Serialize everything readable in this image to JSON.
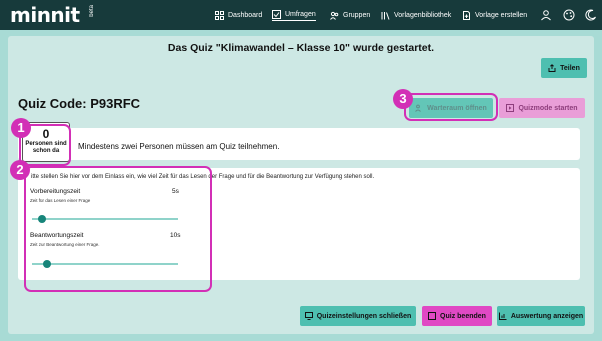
{
  "nav": {
    "logo": "minnit",
    "logo_badge": "beta",
    "items": [
      {
        "label": "Dashboard",
        "icon": "grid-icon"
      },
      {
        "label": "Umfragen",
        "icon": "survey-icon"
      },
      {
        "label": "Gruppen",
        "icon": "group-icon"
      },
      {
        "label": "Vorlagenbibliothek",
        "icon": "library-icon"
      },
      {
        "label": "Vorlage erstellen",
        "icon": "document-plus-icon"
      }
    ],
    "right_icons": [
      "user-icon",
      "palette-icon",
      "moon-icon"
    ]
  },
  "banner": {
    "message": "Das Quiz \"Klimawandel – Klasse 10\" wurde gestartet.",
    "share_label": "Teilen"
  },
  "quiz": {
    "code_label": "Quiz Code: P93RFC",
    "waiting_room_label": "Warteraum öffnen",
    "start_quiz_mode_label": "Quizmode starten"
  },
  "participants": {
    "count": "0",
    "count_label": "Personen sind schon da",
    "minimum_note": "Mindestens zwei Personen müssen am Quiz teilnehmen."
  },
  "timing": {
    "instruction": "itte stellen Sie hier vor dem Einlass ein, wie viel Zeit für das Lesen der Frage und für die Beantwortung zur Verfügung stehen soll.",
    "prep": {
      "label": "Vorbereitungszeit",
      "sub": "Zeit für das Lesen einer Frage",
      "value": "5s",
      "level": 0.05
    },
    "answer": {
      "label": "Beantwortungszeit",
      "sub": "Zeit zur Beantwortung einer Frage.",
      "value": "10s",
      "level": 0.08
    }
  },
  "footer": {
    "close_settings_label": "Quizeinstellungen schließen",
    "end_quiz_label": "Quiz beenden",
    "show_results_label": "Auswertung anzeigen"
  },
  "annotations": [
    "1",
    "2",
    "3"
  ],
  "colors": {
    "nav_bg": "#173a3b",
    "page_bg": "#a8dbd5",
    "panel_bg": "#cde8e4",
    "accent_teal": "#4ebfb0",
    "accent_pink": "#e049c4",
    "highlight": "#d22fb6"
  }
}
